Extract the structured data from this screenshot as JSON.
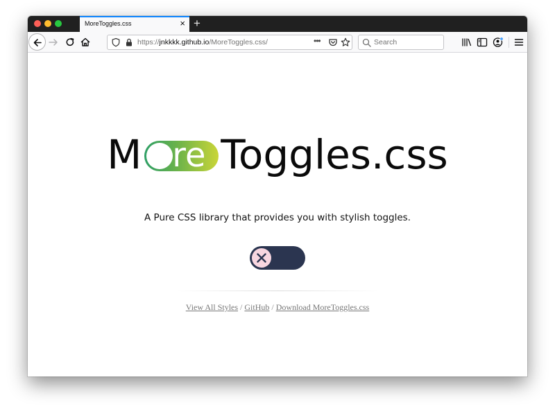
{
  "colors": {
    "brand_gradient_start": "#2e9f66",
    "brand_gradient_end": "#c9d538",
    "toggle_track": "#2b3550",
    "toggle_knob": "#f8d6e0",
    "tab_accent": "#0a84ff"
  },
  "browser": {
    "tab": {
      "title": "MoreToggles.css",
      "close_icon": "×"
    },
    "new_tab_label": "+",
    "url": {
      "prefix": "https://",
      "host": "jnkkkk.github.io",
      "path": "/MoreToggles.css/"
    },
    "url_more_label": "•••",
    "search_placeholder": "Search"
  },
  "page": {
    "title_start": "M",
    "title_pill_text": "re",
    "title_end": "Toggles.css",
    "tagline": "A Pure CSS library that provides you with stylish toggles.",
    "demo_toggle": {
      "state": "off",
      "icon": "close-icon"
    },
    "links": {
      "view_all": "View All Styles",
      "separator": "/",
      "github": "GitHub",
      "download": "Download MoreToggles.css"
    }
  }
}
